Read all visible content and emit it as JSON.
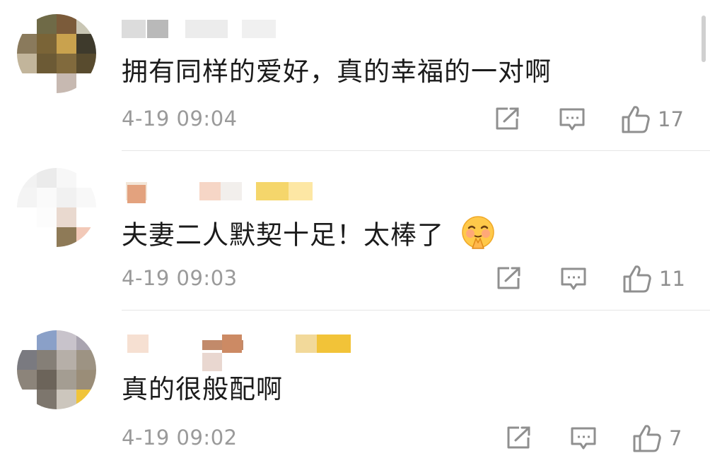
{
  "comments": [
    {
      "text": "拥有同样的爱好，真的幸福的一对啊",
      "time": "4-19 09:04",
      "likes": "17",
      "has_emoji": false
    },
    {
      "text": "夫妻二人默契十足！太棒了",
      "time": "4-19 09:03",
      "likes": "11",
      "has_emoji": true,
      "emoji_name": "pleading-hands-emoji"
    },
    {
      "text": "真的很般配啊",
      "time": "4-19 09:02",
      "likes": "7",
      "has_emoji": false
    }
  ],
  "icons": {
    "share": "share-icon",
    "reply": "comment-icon",
    "like": "thumbs-up-icon"
  },
  "colors": {
    "text": "#1b1b1b",
    "meta": "#9a9a9a",
    "icon": "#8f8f8f",
    "divider": "#e6e6e6"
  }
}
